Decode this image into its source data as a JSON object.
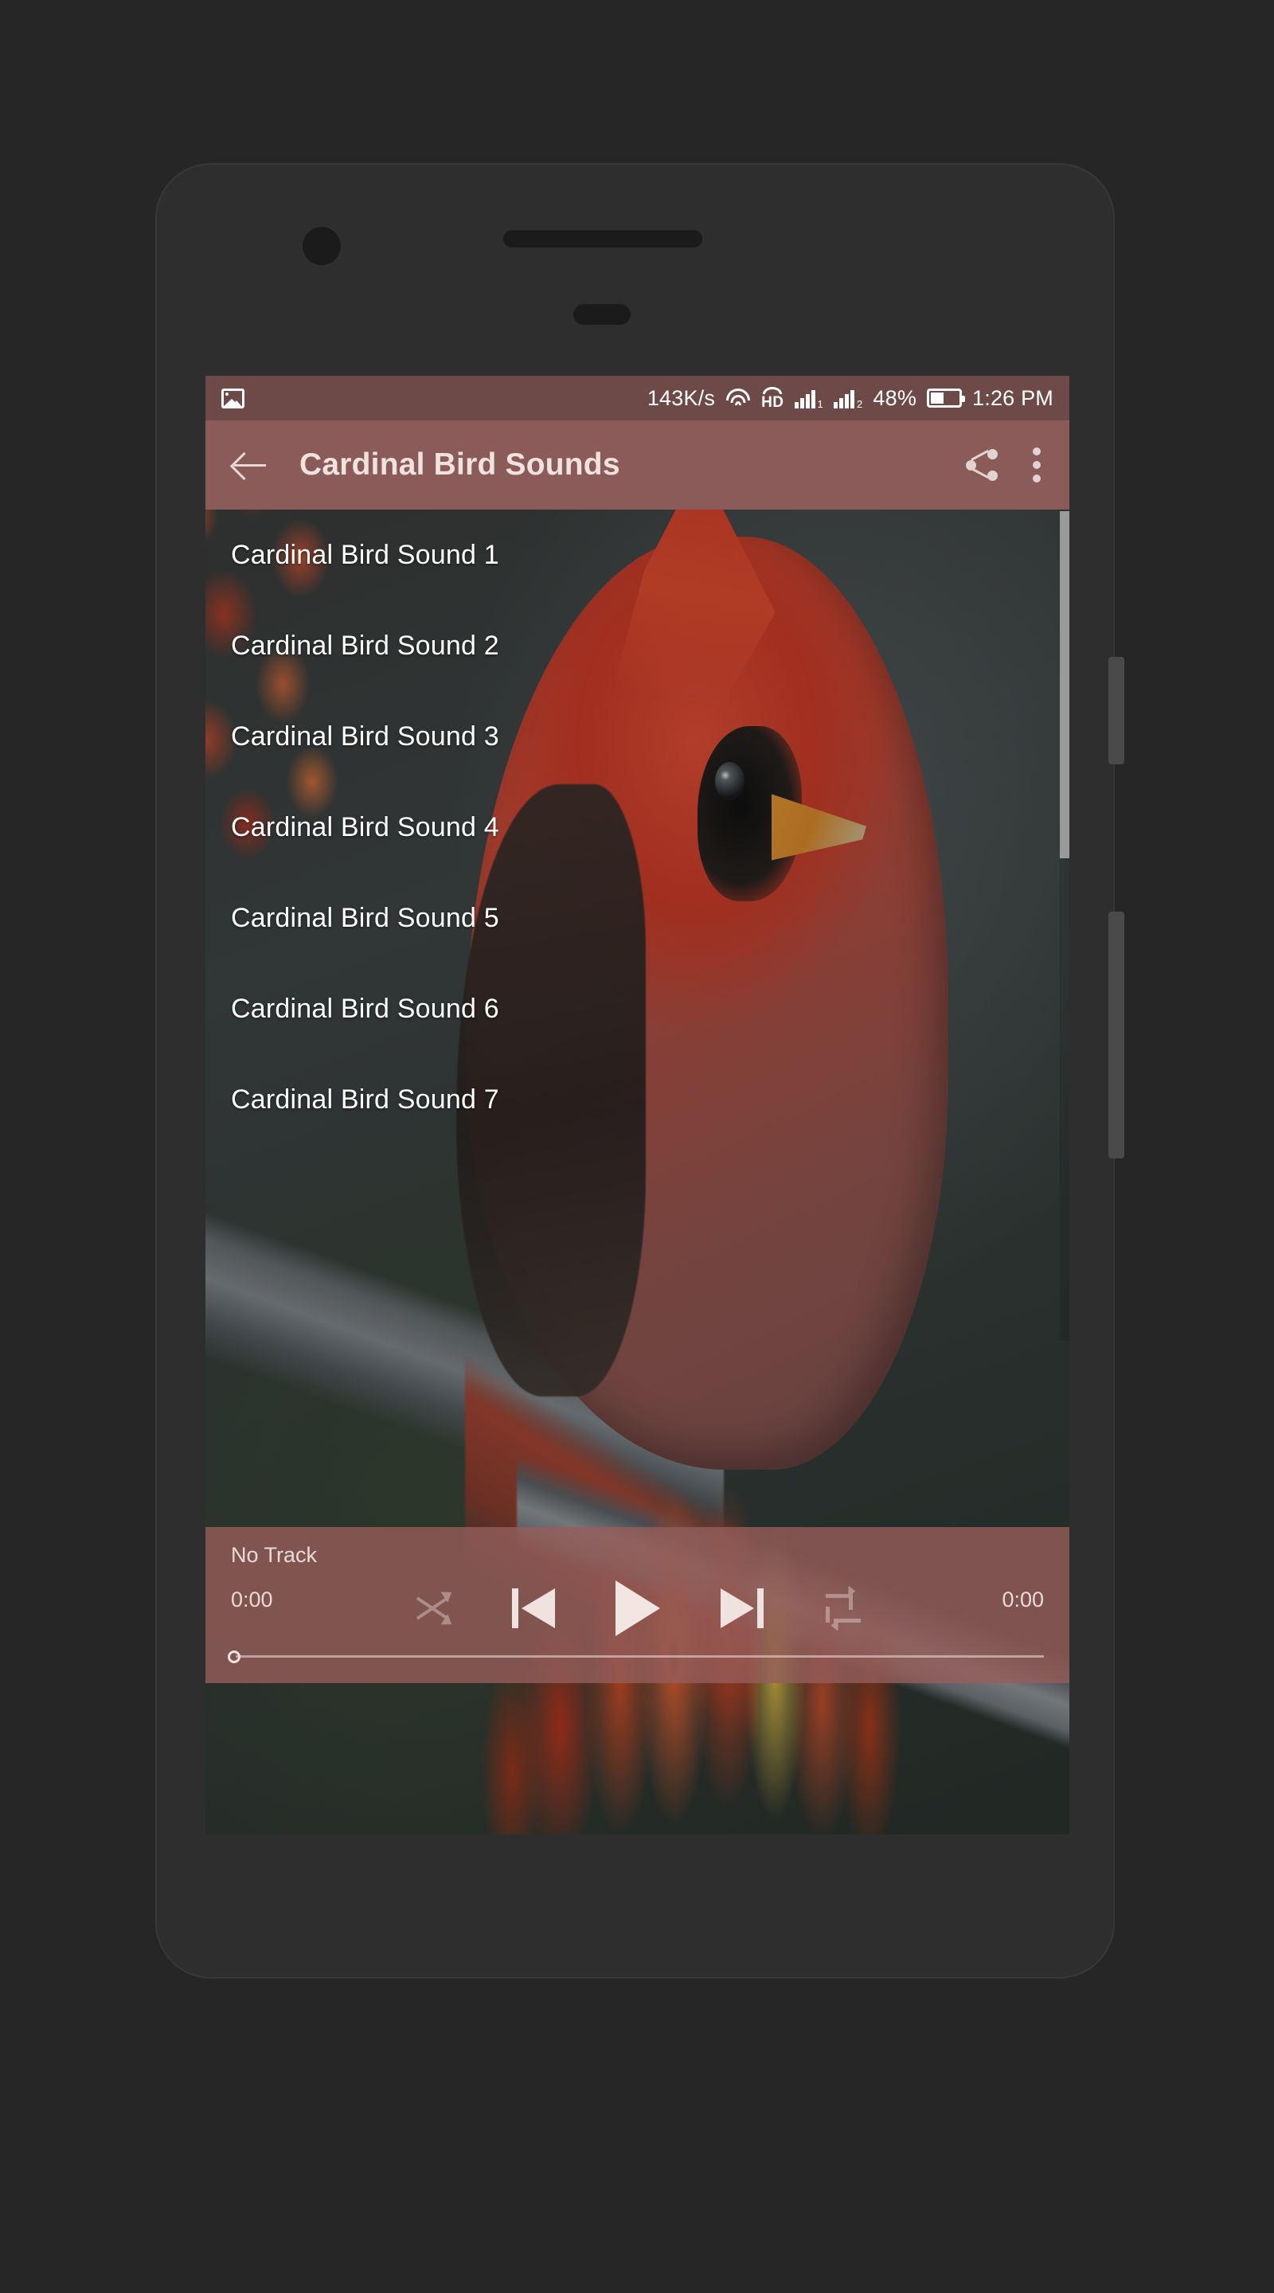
{
  "status_bar": {
    "gallery_icon": "image-icon",
    "network_speed": "143K/s",
    "wifi_icon": "wifi-icon",
    "hd_label": "HD",
    "sim1_icon": "signal-bars-1-icon",
    "sim1_label": "1",
    "sim2_icon": "signal-bars-2-icon",
    "sim2_label": "2",
    "battery_percent": "48%",
    "battery_icon": "battery-icon",
    "clock": "1:26 PM"
  },
  "app_bar": {
    "back_icon": "back-arrow-icon",
    "title": "Cardinal Bird Sounds",
    "share_icon": "share-icon",
    "overflow_icon": "more-vert-icon"
  },
  "sound_list": {
    "items": [
      {
        "label": "Cardinal Bird Sound 1"
      },
      {
        "label": "Cardinal Bird Sound 2"
      },
      {
        "label": "Cardinal Bird Sound 3"
      },
      {
        "label": "Cardinal Bird Sound 4"
      },
      {
        "label": "Cardinal Bird Sound 5"
      },
      {
        "label": "Cardinal Bird Sound 6"
      },
      {
        "label": "Cardinal Bird Sound 7"
      }
    ]
  },
  "player": {
    "track_title": "No Track",
    "time_current": "0:00",
    "time_total": "0:00",
    "shuffle_icon": "shuffle-icon",
    "previous_icon": "skip-previous-icon",
    "play_icon": "play-icon",
    "next_icon": "skip-next-icon",
    "repeat_icon": "repeat-icon",
    "seek_position_percent": 0
  },
  "colors": {
    "status_bar_bg": "#6d4a48",
    "app_bar_bg": "#8a5b58",
    "player_bar_bg": "#965e5a",
    "text_primary": "#ffffff",
    "text_muted": "#e9dad7",
    "scrollbar": "#9a9a9a",
    "frame_bg": "#2e2e2e",
    "page_bg": "#262626"
  }
}
